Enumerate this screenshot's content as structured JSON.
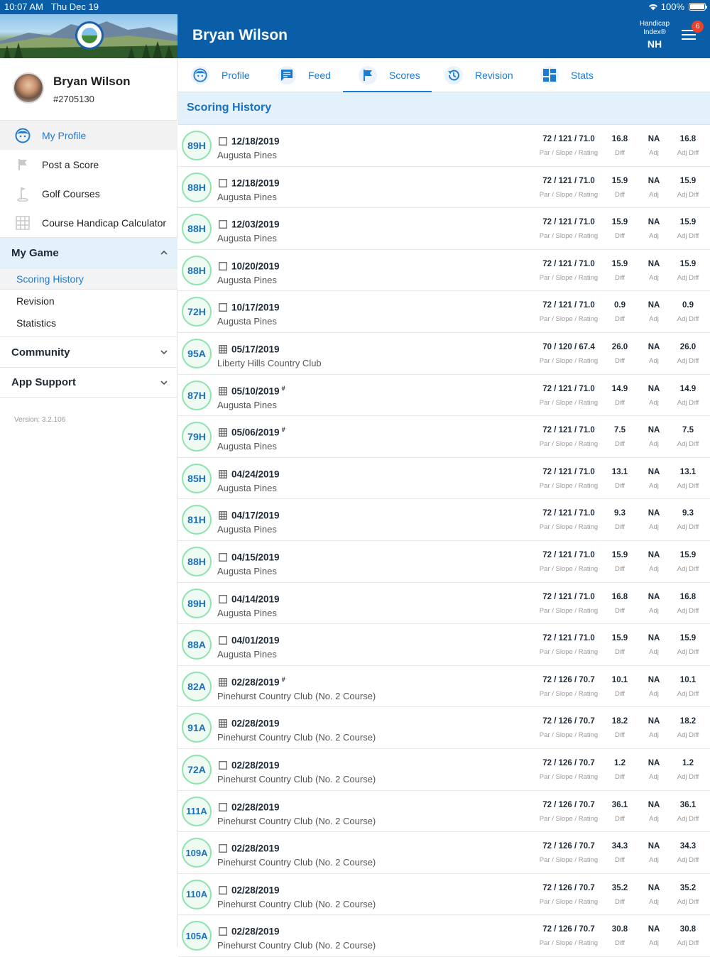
{
  "status": {
    "time": "10:07 AM",
    "date": "Thu Dec 19",
    "battery": "100%",
    "battery_level": 1.0
  },
  "header": {
    "title": "Bryan Wilson",
    "handicap_label_1": "Handicap",
    "handicap_label_2": "Index®",
    "handicap_value": "NH",
    "notification_count": "6"
  },
  "sidebar": {
    "name": "Bryan Wilson",
    "id": "#2705130",
    "nav": [
      {
        "label": "My Profile",
        "icon": "face-icon"
      },
      {
        "label": "Post a Score",
        "icon": "flag-icon"
      },
      {
        "label": "Golf Courses",
        "icon": "golf-hole-icon"
      },
      {
        "label": "Course Handicap Calculator",
        "icon": "calculator-grid-icon"
      }
    ],
    "my_game": "My Game",
    "my_game_items": [
      "Scoring History",
      "Revision",
      "Statistics"
    ],
    "community": "Community",
    "app_support": "App Support",
    "version": "Version: 3.2.106"
  },
  "tabs": [
    {
      "label": "Profile",
      "icon": "face-icon"
    },
    {
      "label": "Feed",
      "icon": "chat-icon"
    },
    {
      "label": "Scores",
      "icon": "flag-icon"
    },
    {
      "label": "Revision",
      "icon": "history-icon"
    },
    {
      "label": "Stats",
      "icon": "dashboard-icon"
    }
  ],
  "content_title": "Scoring History",
  "labels": {
    "psr": "Par / Slope / Rating",
    "diff": "Diff",
    "adj": "Adj",
    "adjdiff": "Adj Diff"
  },
  "scores": [
    {
      "score": "89H",
      "type": "single",
      "date": "12/18/2019",
      "mark": "",
      "course": "Augusta Pines",
      "psr": "72 / 121 / 71.0",
      "diff": "16.8",
      "adj": "NA",
      "adjdiff": "16.8"
    },
    {
      "score": "88H",
      "type": "single",
      "date": "12/18/2019",
      "mark": "",
      "course": "Augusta Pines",
      "psr": "72 / 121 / 71.0",
      "diff": "15.9",
      "adj": "NA",
      "adjdiff": "15.9"
    },
    {
      "score": "88H",
      "type": "single",
      "date": "12/03/2019",
      "mark": "",
      "course": "Augusta Pines",
      "psr": "72 / 121 / 71.0",
      "diff": "15.9",
      "adj": "NA",
      "adjdiff": "15.9"
    },
    {
      "score": "88H",
      "type": "single",
      "date": "10/20/2019",
      "mark": "",
      "course": "Augusta Pines",
      "psr": "72 / 121 / 71.0",
      "diff": "15.9",
      "adj": "NA",
      "adjdiff": "15.9"
    },
    {
      "score": "72H",
      "type": "single",
      "date": "10/17/2019",
      "mark": "",
      "course": "Augusta Pines",
      "psr": "72 / 121 / 71.0",
      "diff": "0.9",
      "adj": "NA",
      "adjdiff": "0.9"
    },
    {
      "score": "95A",
      "type": "grid",
      "date": "05/17/2019",
      "mark": "",
      "course": "Liberty Hills Country Club",
      "psr": "70 / 120 / 67.4",
      "diff": "26.0",
      "adj": "NA",
      "adjdiff": "26.0"
    },
    {
      "score": "87H",
      "type": "grid",
      "date": "05/10/2019",
      "mark": "#",
      "course": "Augusta Pines",
      "psr": "72 / 121 / 71.0",
      "diff": "14.9",
      "adj": "NA",
      "adjdiff": "14.9"
    },
    {
      "score": "79H",
      "type": "grid",
      "date": "05/06/2019",
      "mark": "#",
      "course": "Augusta Pines",
      "psr": "72 / 121 / 71.0",
      "diff": "7.5",
      "adj": "NA",
      "adjdiff": "7.5"
    },
    {
      "score": "85H",
      "type": "grid",
      "date": "04/24/2019",
      "mark": "",
      "course": "Augusta Pines",
      "psr": "72 / 121 / 71.0",
      "diff": "13.1",
      "adj": "NA",
      "adjdiff": "13.1"
    },
    {
      "score": "81H",
      "type": "grid",
      "date": "04/17/2019",
      "mark": "",
      "course": "Augusta Pines",
      "psr": "72 / 121 / 71.0",
      "diff": "9.3",
      "adj": "NA",
      "adjdiff": "9.3"
    },
    {
      "score": "88H",
      "type": "single",
      "date": "04/15/2019",
      "mark": "",
      "course": "Augusta Pines",
      "psr": "72 / 121 / 71.0",
      "diff": "15.9",
      "adj": "NA",
      "adjdiff": "15.9"
    },
    {
      "score": "89H",
      "type": "single",
      "date": "04/14/2019",
      "mark": "",
      "course": "Augusta Pines",
      "psr": "72 / 121 / 71.0",
      "diff": "16.8",
      "adj": "NA",
      "adjdiff": "16.8"
    },
    {
      "score": "88A",
      "type": "single",
      "date": "04/01/2019",
      "mark": "",
      "course": "Augusta Pines",
      "psr": "72 / 121 / 71.0",
      "diff": "15.9",
      "adj": "NA",
      "adjdiff": "15.9"
    },
    {
      "score": "82A",
      "type": "grid",
      "date": "02/28/2019",
      "mark": "#",
      "course": "Pinehurst Country Club (No. 2 Course)",
      "psr": "72 / 126 / 70.7",
      "diff": "10.1",
      "adj": "NA",
      "adjdiff": "10.1"
    },
    {
      "score": "91A",
      "type": "grid",
      "date": "02/28/2019",
      "mark": "",
      "course": "Pinehurst Country Club (No. 2 Course)",
      "psr": "72 / 126 / 70.7",
      "diff": "18.2",
      "adj": "NA",
      "adjdiff": "18.2"
    },
    {
      "score": "72A",
      "type": "single",
      "date": "02/28/2019",
      "mark": "",
      "course": "Pinehurst Country Club (No. 2 Course)",
      "psr": "72 / 126 / 70.7",
      "diff": "1.2",
      "adj": "NA",
      "adjdiff": "1.2"
    },
    {
      "score": "111A",
      "type": "single",
      "date": "02/28/2019",
      "mark": "",
      "course": "Pinehurst Country Club (No. 2 Course)",
      "psr": "72 / 126 / 70.7",
      "diff": "36.1",
      "adj": "NA",
      "adjdiff": "36.1"
    },
    {
      "score": "109A",
      "type": "single",
      "date": "02/28/2019",
      "mark": "",
      "course": "Pinehurst Country Club (No. 2 Course)",
      "psr": "72 / 126 / 70.7",
      "diff": "34.3",
      "adj": "NA",
      "adjdiff": "34.3"
    },
    {
      "score": "110A",
      "type": "single",
      "date": "02/28/2019",
      "mark": "",
      "course": "Pinehurst Country Club (No. 2 Course)",
      "psr": "72 / 126 / 70.7",
      "diff": "35.2",
      "adj": "NA",
      "adjdiff": "35.2"
    },
    {
      "score": "105A",
      "type": "single",
      "date": "02/28/2019",
      "mark": "",
      "course": "Pinehurst Country Club (No. 2 Course)",
      "psr": "72 / 126 / 70.7",
      "diff": "30.8",
      "adj": "NA",
      "adjdiff": "30.8"
    }
  ],
  "colors": {
    "brand_blue": "#0a5ea8",
    "accent_blue": "#1d7bd1",
    "score_ring": "#8fe3b0",
    "badge_red": "#e9432f"
  }
}
